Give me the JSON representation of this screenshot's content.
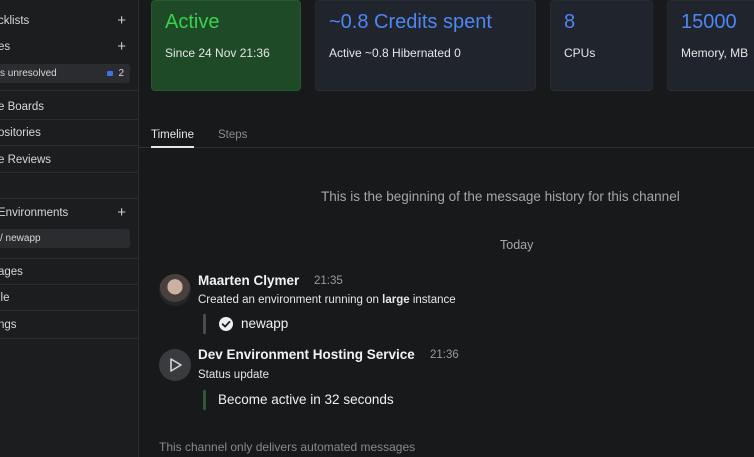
{
  "sidebar": {
    "checklists": "cklists",
    "issues": "es",
    "issues_sub": "s unresolved",
    "issues_count": "2",
    "boards": "e Boards",
    "repositories": "ositories",
    "reviews": "e Reviews",
    "environments": "Environments",
    "env_item": "/ newapp",
    "packages": "ages",
    "profile": "ile",
    "settings": "ngs"
  },
  "cards": [
    {
      "value": "Active",
      "sub": "Since 24 Nov 21:36"
    },
    {
      "value": "~0.8 Credits spent",
      "sub": "Active ~0.8  Hibernated 0"
    },
    {
      "value": "8",
      "sub": "CPUs"
    },
    {
      "value": "15000",
      "sub": "Memory, MB"
    }
  ],
  "tabs": [
    "Timeline",
    "Steps"
  ],
  "history_start": "This is the beginning of the message history for this channel",
  "day_label": "Today",
  "messages": [
    {
      "author": "Maarten Clymer",
      "time": "21:35",
      "text_before": "Created an environment running on ",
      "text_bold": "large",
      "text_after": " instance",
      "quote": "newapp"
    },
    {
      "author": "Dev Environment Hosting Service",
      "time": "21:36",
      "text": "Status update",
      "quote": "Become active in 32 seconds"
    }
  ],
  "footer": "This channel only delivers automated messages",
  "icons": {
    "add": "plus-icon",
    "check": "check-circle-icon",
    "service": "play-icon"
  },
  "colors": {
    "active_green": "#37d24f",
    "accent_blue": "#4f86f2",
    "badge_blue": "#3b74e8"
  }
}
